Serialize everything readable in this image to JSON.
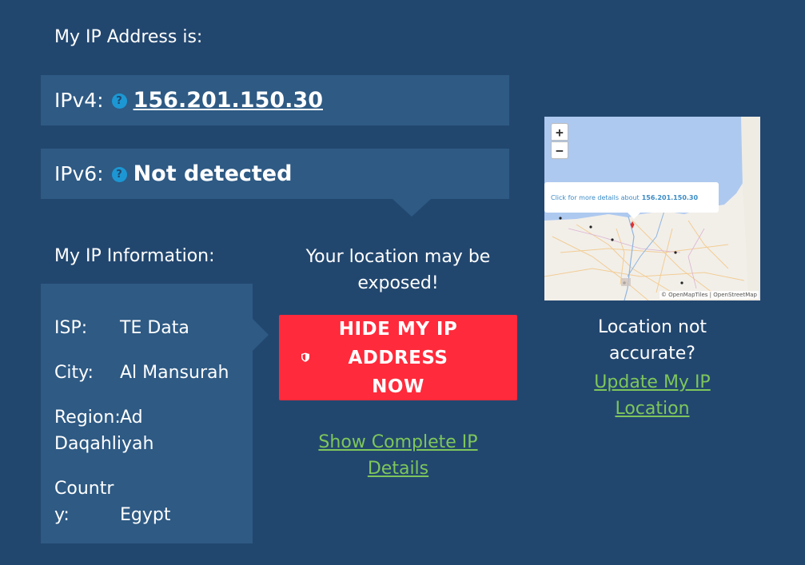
{
  "headings": {
    "my_ip": "My IP Address is:",
    "ip_info": "My IP Information:"
  },
  "ipv4": {
    "label": "IPv4:",
    "value": "156.201.150.30"
  },
  "ipv6": {
    "label": "IPv6:",
    "value": "Not detected"
  },
  "help_glyph": "?",
  "info": {
    "isp_label": "ISP:",
    "isp_value": "TE Data",
    "city_label": "City:",
    "city_value": "Al Mansurah",
    "region_label": "Region:",
    "region_value_1": "Ad",
    "region_value_2": "Daqahliyah",
    "country_label_1": "Countr",
    "country_label_2": "y:",
    "country_value": "Egypt"
  },
  "exposed": {
    "line1": "Your location may be",
    "line2": "exposed!"
  },
  "hide_button": {
    "line1": "HIDE MY IP",
    "line2": "ADDRESS NOW",
    "icon": "shield-icon"
  },
  "show_details": {
    "line1": "Show Complete IP",
    "line2": "Details"
  },
  "location": {
    "not_accurate_1": "Location not",
    "not_accurate_2": "accurate?",
    "update_1": "Update My IP",
    "update_2": "Location"
  },
  "map": {
    "zoom_in": "+",
    "zoom_out": "−",
    "popup_text": "Click for more details about",
    "popup_ip": "156.201.150.30",
    "attribution": "© OpenMapTiles | OpenStreetMap"
  },
  "colors": {
    "background": "#22476f",
    "panel": "#2e5a84",
    "button": "#ff2a3b",
    "link": "#7ec65b",
    "help_icon": "#1c97d3"
  }
}
